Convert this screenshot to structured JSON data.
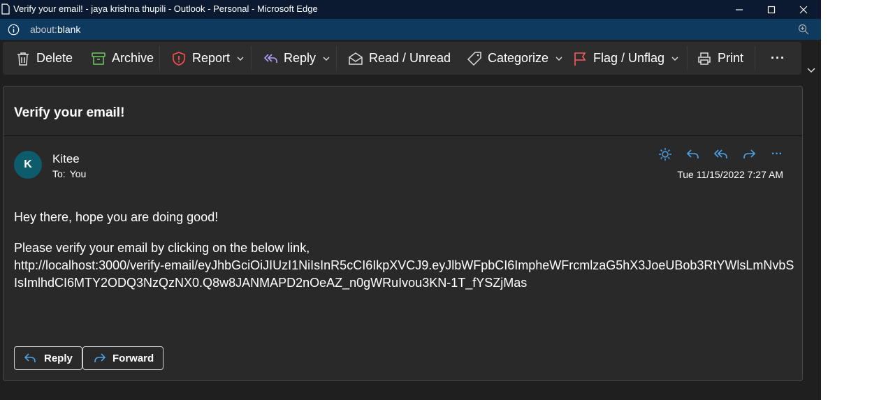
{
  "window": {
    "title": "Verify your email! - jaya krishna thupili - Outlook - Personal - Microsoft Edge"
  },
  "address": {
    "url_prefix": "about:",
    "url_rest": "blank"
  },
  "toolbar": {
    "delete_label": "Delete",
    "archive_label": "Archive",
    "report_label": "Report",
    "reply_label": "Reply",
    "read_unread_label": "Read / Unread",
    "categorize_label": "Categorize",
    "flag_label": "Flag / Unflag",
    "print_label": "Print",
    "more_label": "···"
  },
  "message": {
    "subject": "Verify your email!",
    "avatar_initial": "K",
    "sender": "Kitee",
    "to_label": "To:",
    "to_value": "You",
    "date": "Tue 11/15/2022 7:27 AM",
    "actions_more": "···",
    "body_line1": "Hey there, hope you are doing good!",
    "body_line2": "Please verify your email by clicking on the below link,",
    "body_link": "http://localhost:3000/verify-email/eyJhbGciOiJIUzI1NiIsInR5cCI6IkpXVCJ9.eyJlbWFpbCI6ImpheWFrcmlzaG5hX3JoeUBob3RtYWlsLmNvbSIsImlhdCI6MTY2ODQ3NzQzNX0.Q8w8JANMAPD2nOeAZ_n0gWRuIvou3KN-1T_fYSZjMas",
    "reply_button": "Reply",
    "forward_button": "Forward"
  },
  "colors": {
    "accent": "#4aa3e8",
    "archive_icon": "#6ccb5f",
    "report_icon": "#ff4d4d",
    "reply_icon": "#b4a0ff",
    "flag_icon": "#ff5a5a",
    "avatar_bg": "#0d5c6b"
  }
}
